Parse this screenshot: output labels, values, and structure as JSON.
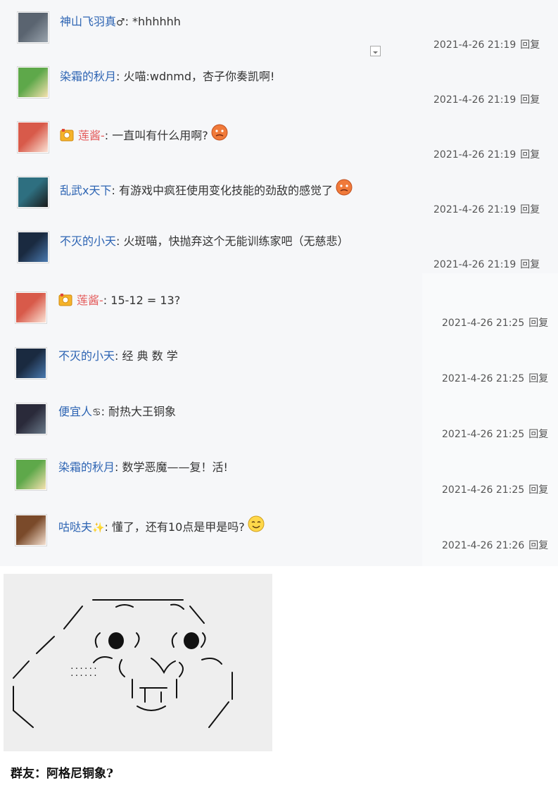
{
  "reply_label": "回复",
  "block1": [
    {
      "user": "神山飞羽真",
      "badge": "♂",
      "text": ": *hhhhhh",
      "time": "2021-4-26 21:19",
      "avatar": "rainy-scene-avatar",
      "medal": false,
      "emoji": null,
      "expand": true,
      "red": false
    },
    {
      "user": "染霜的秋月",
      "text": ": 火喵:wdnmd，杏子你奏凯啊!",
      "time": "2021-4-26 21:19",
      "avatar": "green-hair-girl-avatar",
      "medal": false,
      "emoji": null,
      "red": false
    },
    {
      "user": "莲酱-",
      "text": ": 一直叫有什么用啊?",
      "time": "2021-4-26 21:19",
      "avatar": "red-hair-girl-avatar",
      "medal": true,
      "emoji": "angry-face-emoji",
      "red": true
    },
    {
      "user": "乱武x天下",
      "text": ": 有游戏中疯狂使用变化技能的劲敌的感觉了",
      "time": "2021-4-26 21:19",
      "avatar": "dark-figure-avatar",
      "medal": false,
      "emoji": "angry-face-emoji",
      "red": false
    },
    {
      "user": "不灭的小天",
      "text": ": 火斑喵，快抛弃这个无能训练家吧（无慈悲）",
      "time": "2021-4-26 21:19",
      "avatar": "dark-hair-boy-avatar",
      "medal": false,
      "emoji": null,
      "red": false
    }
  ],
  "block2": [
    {
      "user": "莲酱-",
      "text": ": 15-12 = 13?",
      "time": "2021-4-26 21:25",
      "avatar": "red-hair-girl-avatar",
      "medal": true,
      "emoji": null,
      "red": true
    },
    {
      "user": "不灭的小天",
      "text": ": 经 典 数 学",
      "time": "2021-4-26 21:25",
      "avatar": "dark-hair-boy-avatar",
      "medal": false,
      "emoji": null,
      "red": false
    },
    {
      "user": "便宜人",
      "badge": "♋",
      "text": ": 耐热大王铜象",
      "time": "2021-4-26 21:25",
      "avatar": "night-scene-avatar",
      "medal": false,
      "emoji": null,
      "red": false
    },
    {
      "user": "染霜的秋月",
      "text": ": 数学恶魔——复！活!",
      "time": "2021-4-26 21:25",
      "avatar": "green-hair-girl-avatar",
      "medal": false,
      "emoji": null,
      "red": false
    },
    {
      "user": "咕哒夫",
      "badge": "✨",
      "text": ": 懂了，还有10点是甲是吗?",
      "time": "2021-4-26 21:26",
      "avatar": "brown-hair-girl-avatar",
      "medal": false,
      "emoji": "smile-face-emoji",
      "red": false
    }
  ],
  "caption": "群友：阿格尼铜象?"
}
